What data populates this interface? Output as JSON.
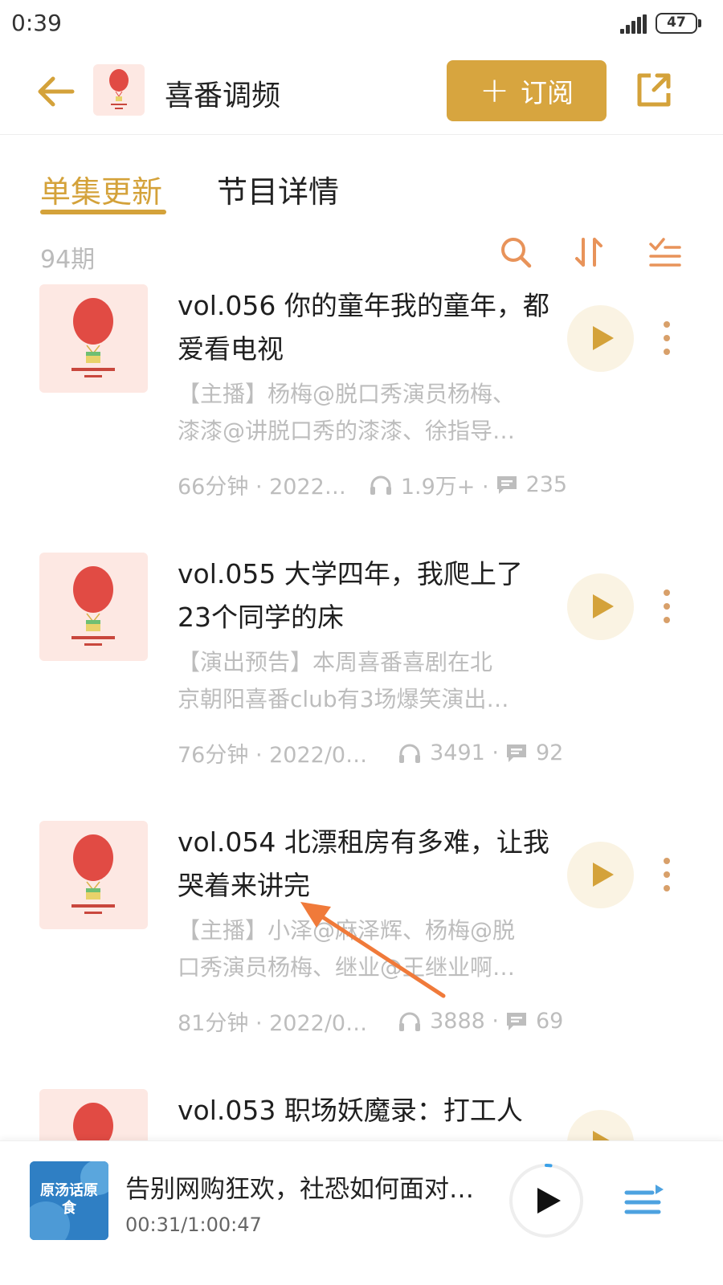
{
  "status_bar": {
    "time": "0:39",
    "battery": "47"
  },
  "header": {
    "channel_name": "喜番调频",
    "subscribe_label": "订阅"
  },
  "tabs": [
    {
      "label": "单集更新",
      "active": true
    },
    {
      "label": "节目详情",
      "active": false
    }
  ],
  "list": {
    "count": "94期"
  },
  "episodes": [
    {
      "title": "vol.056 你的童年我的童年，都爱看电视",
      "desc": "【主播】杨梅@脱口秀演员杨梅、\n漆漆@讲脱口秀的漆漆、徐指导…",
      "duration": "66分钟 · 2022…",
      "plays": "1.9万+ ·",
      "comments": "235"
    },
    {
      "title": "vol.055 大学四年，我爬上了23个同学的床",
      "desc": "【演出预告】本周喜番喜剧在北\n京朝阳喜番club有3场爆笑演出…",
      "duration": "76分钟 · 2022/0…",
      "plays": "3491 ·",
      "comments": "92"
    },
    {
      "title": "vol.054 北漂租房有多难，让我哭着来讲完",
      "desc": "【主播】小泽@麻泽辉、杨梅@脱\n口秀演员杨梅、继业@王继业啊…",
      "duration": "81分钟 · 2022/0…",
      "plays": "3888 ·",
      "comments": "69"
    },
    {
      "title": "vol.053 职场妖魔录：打工人",
      "desc": "",
      "duration": "",
      "plays": "",
      "comments": ""
    }
  ],
  "player": {
    "title": "告别网购狂欢，社恐如何面对…",
    "time": "00:31/1:00:47",
    "cover_text": "原汤话原食",
    "progress": 0.0085
  },
  "colors": {
    "accent": "#d7a53f",
    "balloon": "#e14b44",
    "cover_bg": "#fde8e3",
    "icon_orange": "#e8935a",
    "play_bg": "#faf3e3"
  }
}
